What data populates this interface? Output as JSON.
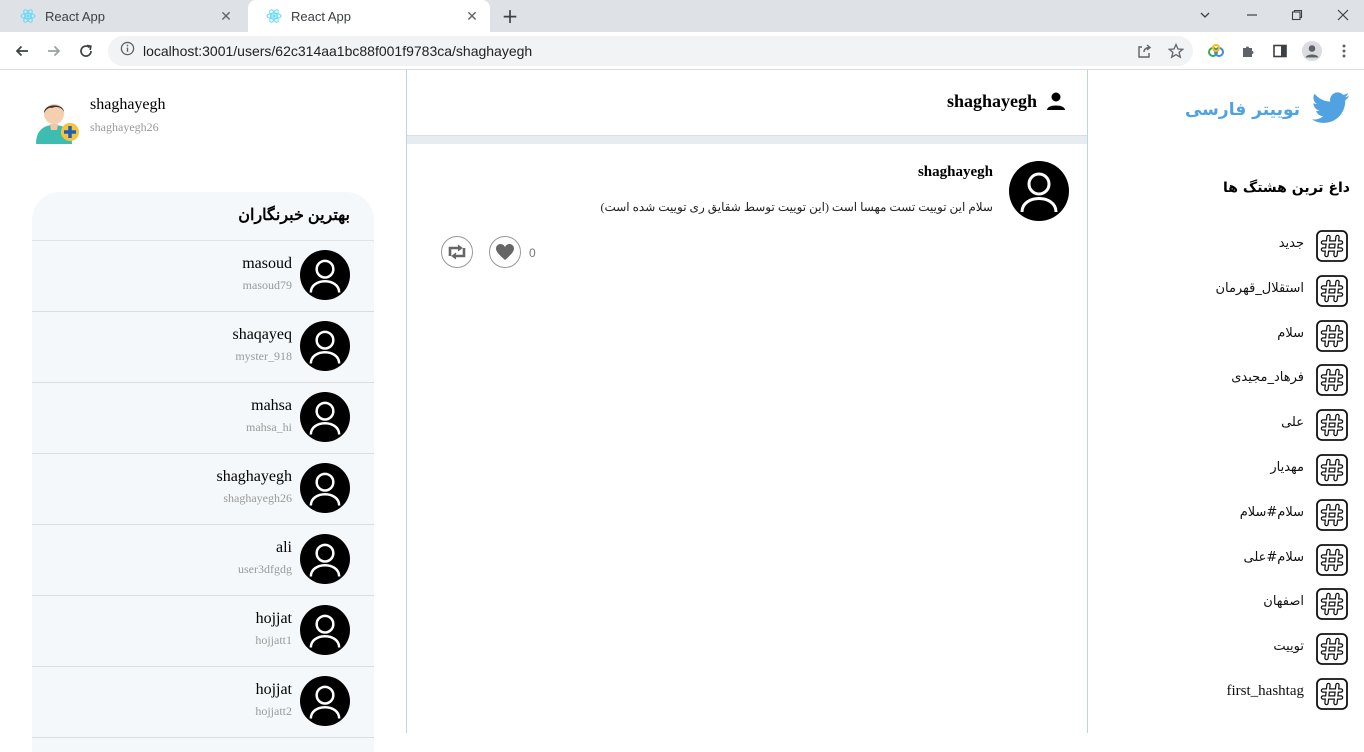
{
  "browser": {
    "tabs": [
      {
        "title": "React App",
        "active": false
      },
      {
        "title": "React App",
        "active": true
      }
    ],
    "url": "localhost:3001/users/62c314aa1bc88f001f9783ca/shaghayegh"
  },
  "profile": {
    "name": "shaghayegh",
    "handle": "shaghayegh26"
  },
  "writers": {
    "title": "بهترین خبرنگاران",
    "items": [
      {
        "name": "masoud",
        "handle": "masoud79"
      },
      {
        "name": "shaqayeq",
        "handle": "myster_918"
      },
      {
        "name": "mahsa",
        "handle": "mahsa_hi"
      },
      {
        "name": "shaghayegh",
        "handle": "shaghayegh26"
      },
      {
        "name": "ali",
        "handle": "user3dfgdg"
      },
      {
        "name": "hojjat",
        "handle": "hojjatt1"
      },
      {
        "name": "hojjat",
        "handle": "hojjatt2"
      }
    ]
  },
  "main": {
    "header_name": "shaghayegh",
    "tweet": {
      "author": "shaghayegh",
      "text": "سلام این توییت تست مهسا است (این توییت توسط شقایق ری توییت شده است)",
      "likes": "0"
    }
  },
  "sidebar": {
    "brand": "توییتر فارسی",
    "hashtags_title": "داغ ترین هشتگ ها",
    "hashtags": [
      "جدید",
      "استقلال_قهرمان",
      "سلام",
      "فرهاد_مجیدی",
      "علی",
      "مهدیار",
      "سلام#سلام",
      "سلام#علی",
      "اصفهان",
      "توییت",
      "first_hashtag"
    ]
  },
  "colors": {
    "brand_blue": "#50a3e0",
    "panel_bg": "#f5f8fa",
    "divider_blue": "#bcd4ea"
  }
}
